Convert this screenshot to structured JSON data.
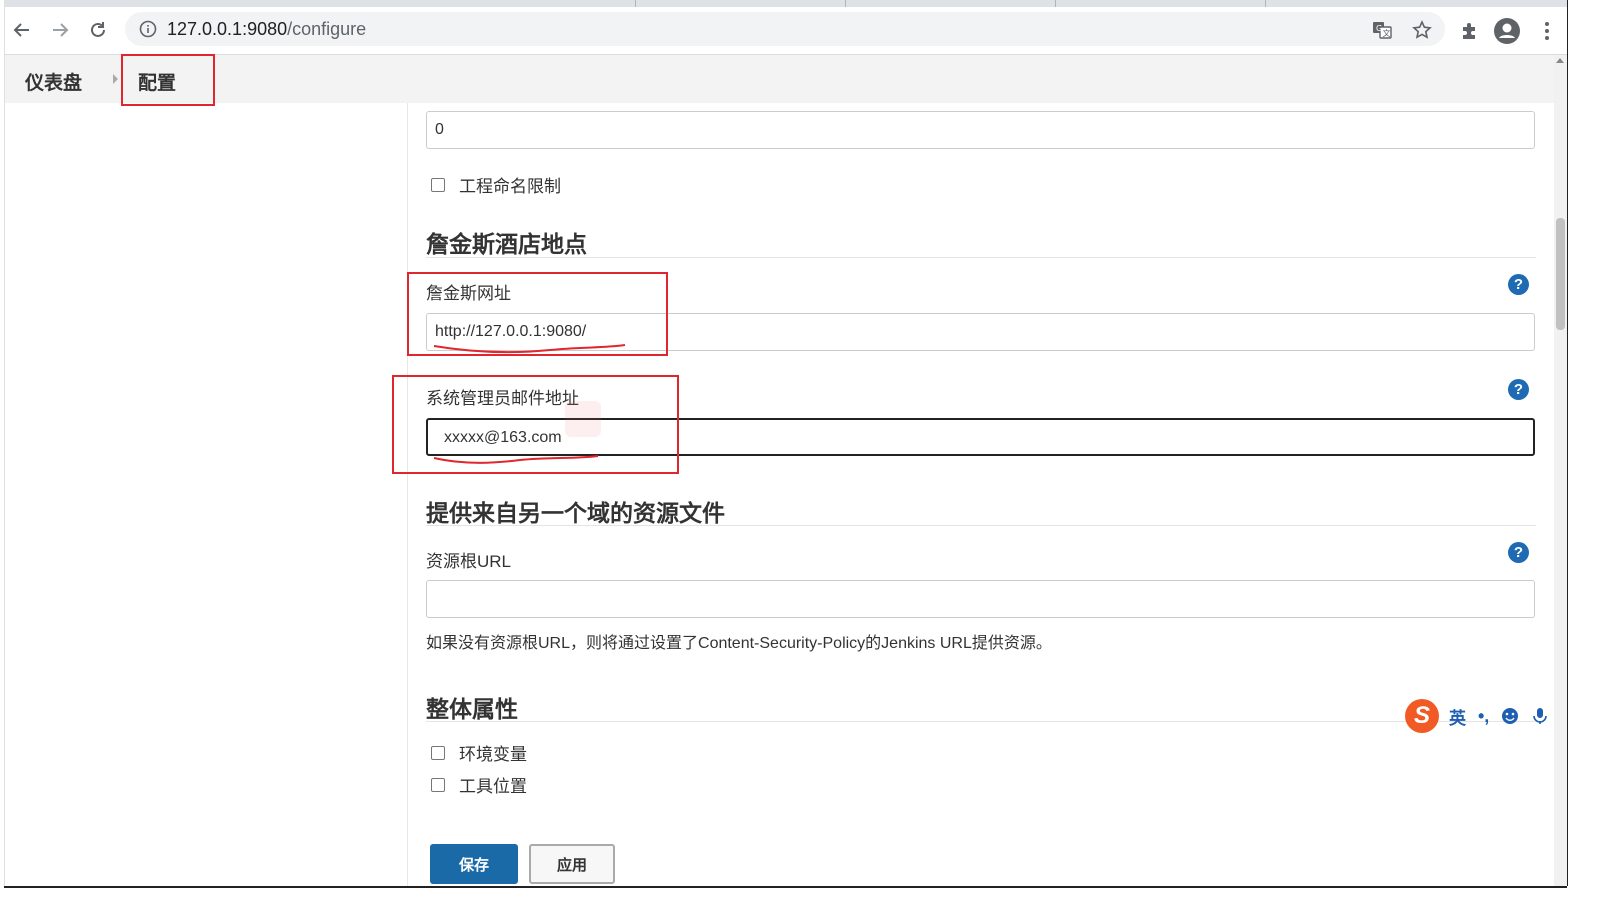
{
  "browser": {
    "url_host": "127.0.0.1:9080",
    "url_path": "/configure",
    "icons": [
      "back-arrow-icon",
      "forward-arrow-icon",
      "reload-icon",
      "info-icon",
      "translate-icon",
      "star-icon",
      "puzzle-icon",
      "account-icon",
      "menu-dots-icon"
    ]
  },
  "breadcrumb": {
    "dashboard": "仪表盘",
    "configure": "配置"
  },
  "top_field": {
    "value": "0"
  },
  "project_naming": {
    "label": "工程命名限制",
    "checked": false
  },
  "location_section": {
    "title": "詹金斯酒店地点",
    "url_label": "詹金斯网址",
    "url_value": "http://127.0.0.1:9080/",
    "email_label": "系统管理员邮件地址",
    "email_value": "xxxxx@163.com"
  },
  "resource_section": {
    "title": "提供来自另一个域的资源文件",
    "root_url_label": "资源根URL",
    "root_url_value": "",
    "hint": "如果没有资源根URL，则将通过设置了Content-Security-Policy的Jenkins URL提供资源。"
  },
  "global_section": {
    "title": "整体属性",
    "env_vars": "环境变量",
    "tool_locations": "工具位置"
  },
  "help": {
    "symbol": "?"
  },
  "buttons": {
    "save": "保存",
    "apply": "应用"
  },
  "ime": {
    "logo": "S",
    "mode": "英",
    "punct": "•,"
  },
  "colors": {
    "annotation_red": "#e0262e",
    "primary_blue": "#1a6aa8",
    "help_blue": "#1e6bb3"
  }
}
